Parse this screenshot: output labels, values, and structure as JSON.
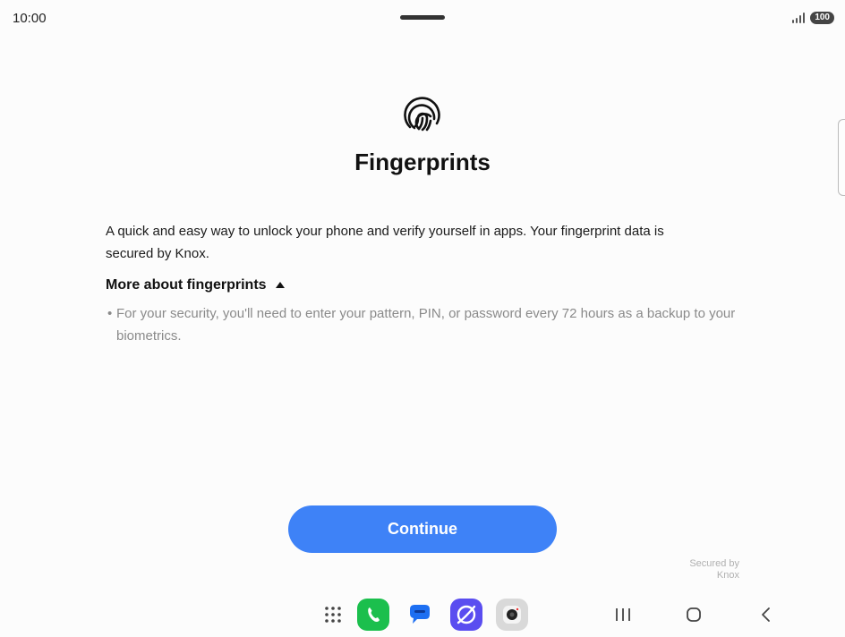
{
  "status_bar": {
    "time": "10:00",
    "battery": "100"
  },
  "page": {
    "title": "Fingerprints",
    "description": "A quick and easy way to unlock your phone and verify yourself in apps. Your fingerprint data is secured by Knox.",
    "more_label": "More about fingerprints",
    "bullet_text": "For your security, you'll need to enter your pattern, PIN, or password every 72 hours as a backup to your biometrics.",
    "continue_label": "Continue",
    "knox_line1": "Secured by",
    "knox_line2": "Knox"
  },
  "icons": {
    "header": "fingerprint-icon",
    "dock": [
      "apps-grid-icon",
      "phone-icon",
      "messages-icon",
      "browser-icon",
      "camera-icon"
    ],
    "nav": [
      "recent-apps-icon",
      "home-icon",
      "back-icon"
    ]
  },
  "colors": {
    "accent": "#3e82f7",
    "background": "#fcfcfc",
    "secondary_text": "#8a8a8a"
  }
}
